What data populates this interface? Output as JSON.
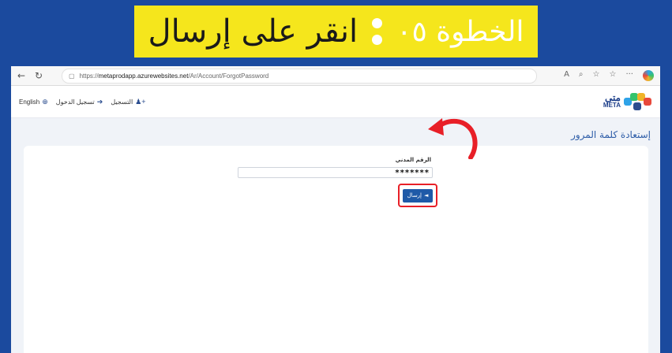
{
  "banner": {
    "step": "الخطوة ٠٥",
    "action": "انقر على إرسال"
  },
  "browser": {
    "url_prefix": "https://",
    "url_host": "metaprodapp.azurewebsites.net",
    "url_path": "/Ar/Account/ForgotPassword"
  },
  "site": {
    "english_link": "English",
    "login_link": "تسجيل الدخول",
    "register_link": "التسجيل",
    "logo_ar": "متى",
    "logo_en": "META"
  },
  "page": {
    "title": "إستعادة كلمة المرور",
    "field_label": "الرقم المدني",
    "field_value": "*******",
    "submit_label": "إرسال"
  },
  "colors": {
    "banner": "#f5e61c",
    "background": "#1b4a9e",
    "accent": "#1f5aa8",
    "highlight": "#e81f27"
  }
}
